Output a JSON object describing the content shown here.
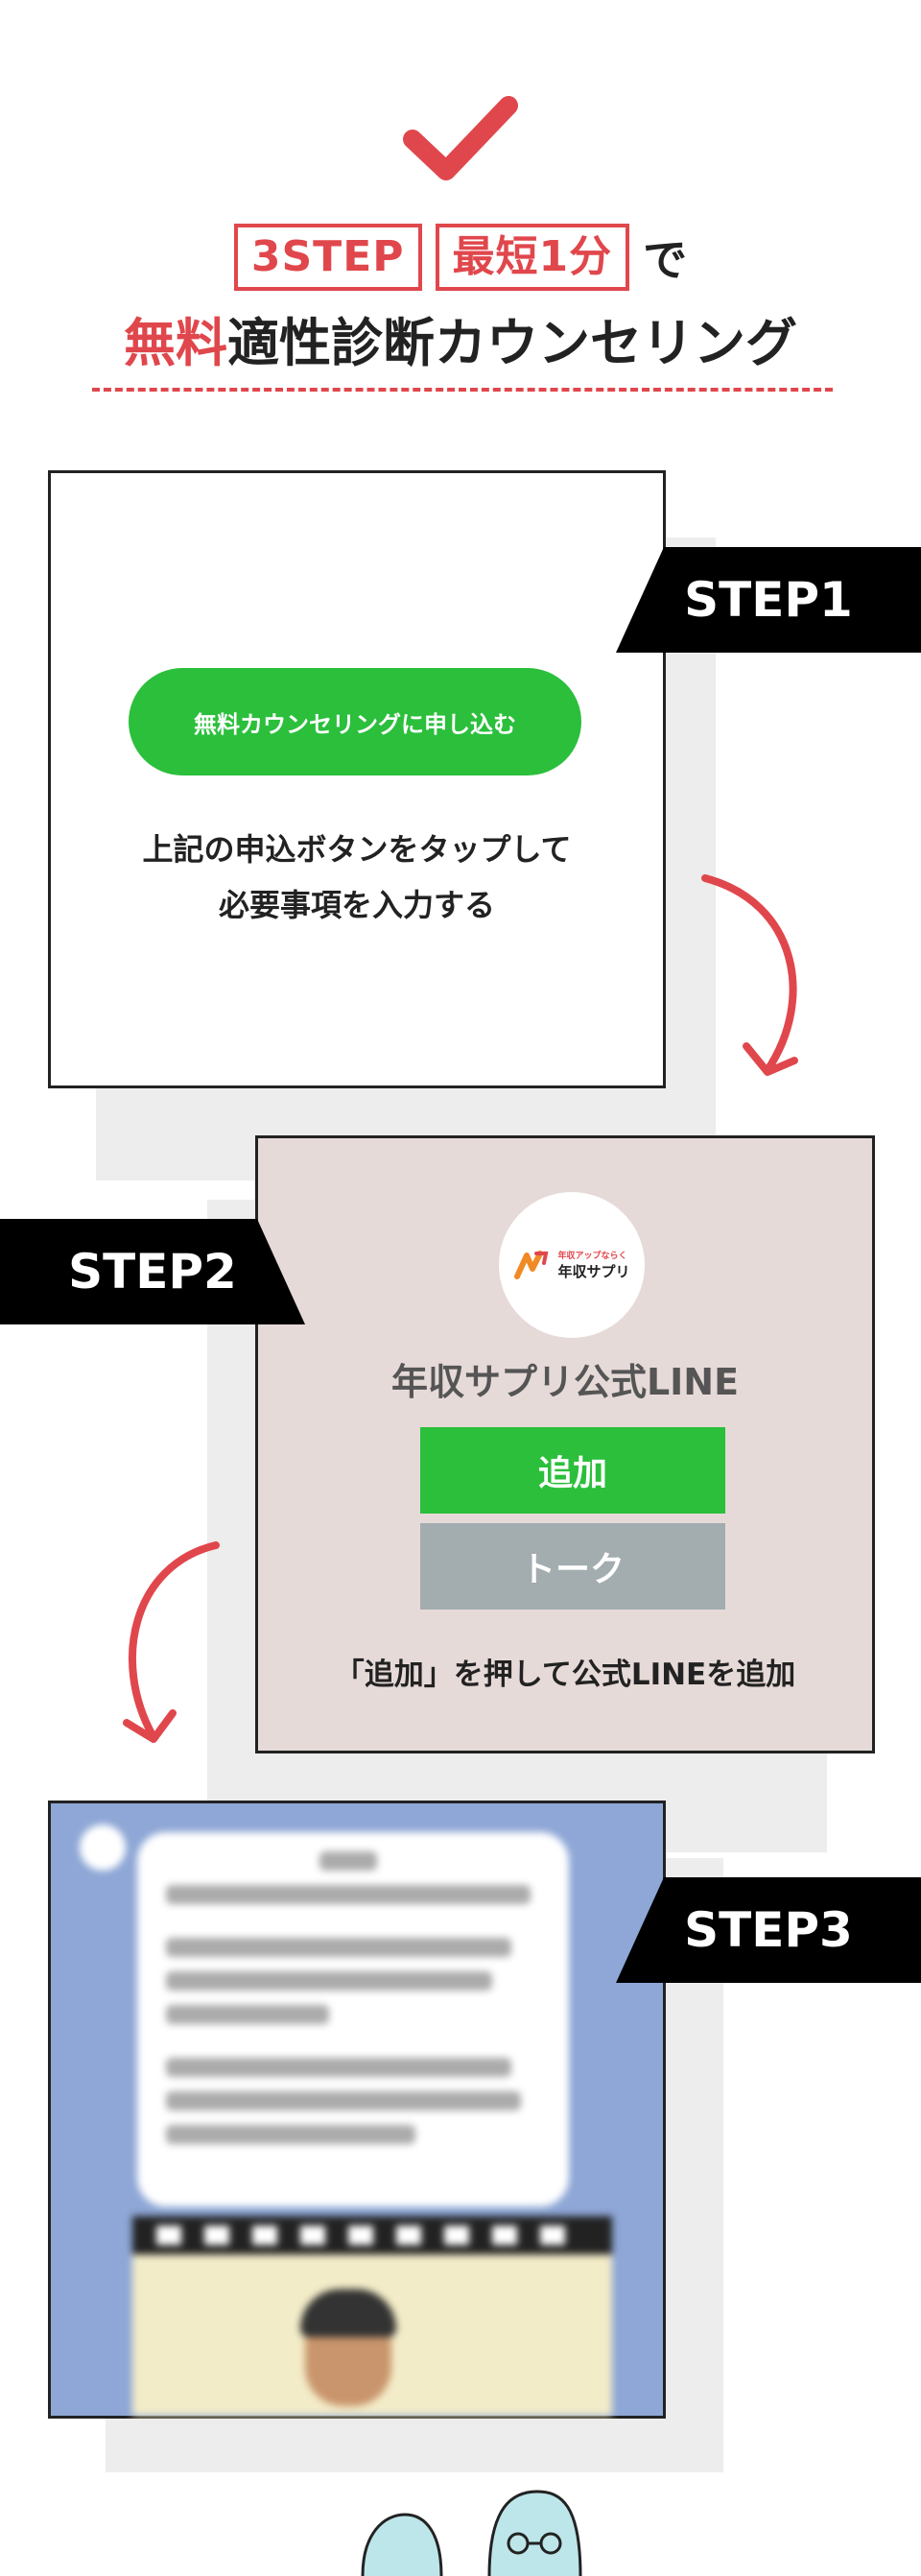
{
  "header": {
    "box1": "3STEP",
    "box2": "最短1分",
    "suffix": "で",
    "title_red": "無料",
    "title_rest": "適性診断カウンセリング"
  },
  "steps": [
    {
      "label": "STEP1",
      "button": "無料カウンセリングに申し込む",
      "line1": "上記の申込ボタンをタップして",
      "line2": "必要事項を入力する"
    },
    {
      "label": "STEP2",
      "logo_small": "年収アップならく",
      "logo_text": "年収サプリ",
      "title": "年収サプリ公式LINE",
      "add_button": "追加",
      "talk_button": "トーク",
      "caption": "「追加」を押して公式LINEを追加"
    },
    {
      "label": "STEP3"
    }
  ],
  "colors": {
    "accent_red": "#e0474c",
    "line_green": "#2bbf3c",
    "ribbon_black": "#000000"
  }
}
